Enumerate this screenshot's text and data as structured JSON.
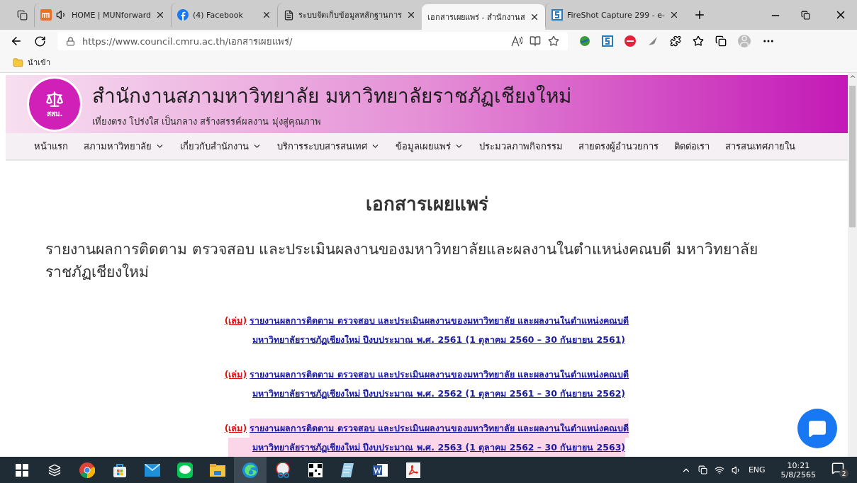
{
  "browser": {
    "tabs": [
      {
        "kind": "munforward",
        "title": "HOME | MUNforward",
        "selected": false,
        "audio": true
      },
      {
        "kind": "facebook",
        "title": "(4) Facebook",
        "selected": false,
        "audio": false
      },
      {
        "kind": "document",
        "title": "ระบบจัดเก็บข้อมูลหลักฐานการ",
        "selected": false,
        "audio": false
      },
      {
        "kind": "none",
        "title": "เอกสารเผยแพร่ - สำนักงานส",
        "selected": true,
        "audio": false
      },
      {
        "kind": "fireshot",
        "title": "FireShot Capture 299 - e-",
        "selected": false,
        "audio": false
      }
    ],
    "address": "https://www.council.cmru.ac.th/เอกสารเผยแพร่/",
    "bookmarks": [
      {
        "label": "นำเข้า"
      }
    ]
  },
  "site": {
    "logo_text": "สสม.",
    "title": "สำนักงานสภามหาวิทยาลัย มหาวิทยาลัยราชภัฏเชียงใหม่",
    "tagline": "เที่ยงตรง โปร่งใส เป็นกลาง สร้างสรรค์ผลงาน มุ่งสู่คุณภาพ",
    "nav": [
      {
        "label": "หน้าแรก",
        "has_menu": false
      },
      {
        "label": "สภามหาวิทยาลัย",
        "has_menu": true
      },
      {
        "label": "เกี่ยวกับสำนักงาน",
        "has_menu": true
      },
      {
        "label": "บริการระบบสารสนเทศ",
        "has_menu": true
      },
      {
        "label": "ข้อมูลเผยแพร่",
        "has_menu": true
      },
      {
        "label": "ประมวลภาพกิจกรรม",
        "has_menu": false
      },
      {
        "label": "สายตรงผู้อำนวยการ",
        "has_menu": false
      },
      {
        "label": "ติดต่อเรา",
        "has_menu": false
      },
      {
        "label": "สารสนเทศภายใน",
        "has_menu": false
      }
    ]
  },
  "page": {
    "heading": "เอกสารเผยแพร่",
    "subheading": "รายงานผลการติดตาม ตรวจสอบ และประเมินผลงานของมหาวิทยาลัยและผลงานในตำแหน่งคณบดี มหาวิทยาลัยราชภัฏเชียงใหม่",
    "documents": [
      {
        "tag": "(เล่ม)",
        "line1": "รายงานผลการติดตาม ตรวจสอบ และประเมินผลงานของมหาวิทยาลัย และผลงานในตำแหน่งคณบดี",
        "line2": "มหาวิทยาลัยราชภัฏเชียงใหม่ ปีงบประมาณ พ.ศ. 2561 (1 ตุลาคม 2560 – 30 กันยายน 2561)",
        "highlighted": false
      },
      {
        "tag": "(เล่ม)",
        "line1": "รายงานผลการติดตาม ตรวจสอบ และประเมินผลงานของมหาวิทยาลัย และผลงานในตำแหน่งคณบดี",
        "line2": "มหาวิทยาลัยราชภัฏเชียงใหม่ ปีงบประมาณ พ.ศ. 2562 (1 ตุลาคม 2561 – 30 กันยายน 2562)",
        "highlighted": false
      },
      {
        "tag": "(เล่ม)",
        "line1": "รายงานผลการติดตาม ตรวจสอบ และประเมินผลงานของมหาวิทยาลัย และผลงานในตำแหน่งคณบดี",
        "line2": "มหาวิทยาลัยราชภัฏเชียงใหม่ ปีงบประมาณ พ.ศ. 2563 (1 ตุลาคม 2562 – 30 กันยายน 2563)",
        "highlighted": true
      }
    ]
  },
  "taskbar": {
    "apps": [
      {
        "kind": "start",
        "selected": false
      },
      {
        "kind": "taskview",
        "selected": false
      },
      {
        "kind": "chrome",
        "selected": false
      },
      {
        "kind": "store",
        "selected": false
      },
      {
        "kind": "mail",
        "selected": false
      },
      {
        "kind": "line",
        "selected": false
      },
      {
        "kind": "explorer",
        "selected": false
      },
      {
        "kind": "edge",
        "selected": true
      },
      {
        "kind": "snip",
        "selected": false
      },
      {
        "kind": "qr",
        "selected": false
      },
      {
        "kind": "notepad",
        "selected": false
      },
      {
        "kind": "word",
        "selected": false
      },
      {
        "kind": "pdf",
        "selected": false
      }
    ],
    "language": "ENG",
    "time": "10:21",
    "date": "5/8/2565",
    "notifications": "2"
  }
}
